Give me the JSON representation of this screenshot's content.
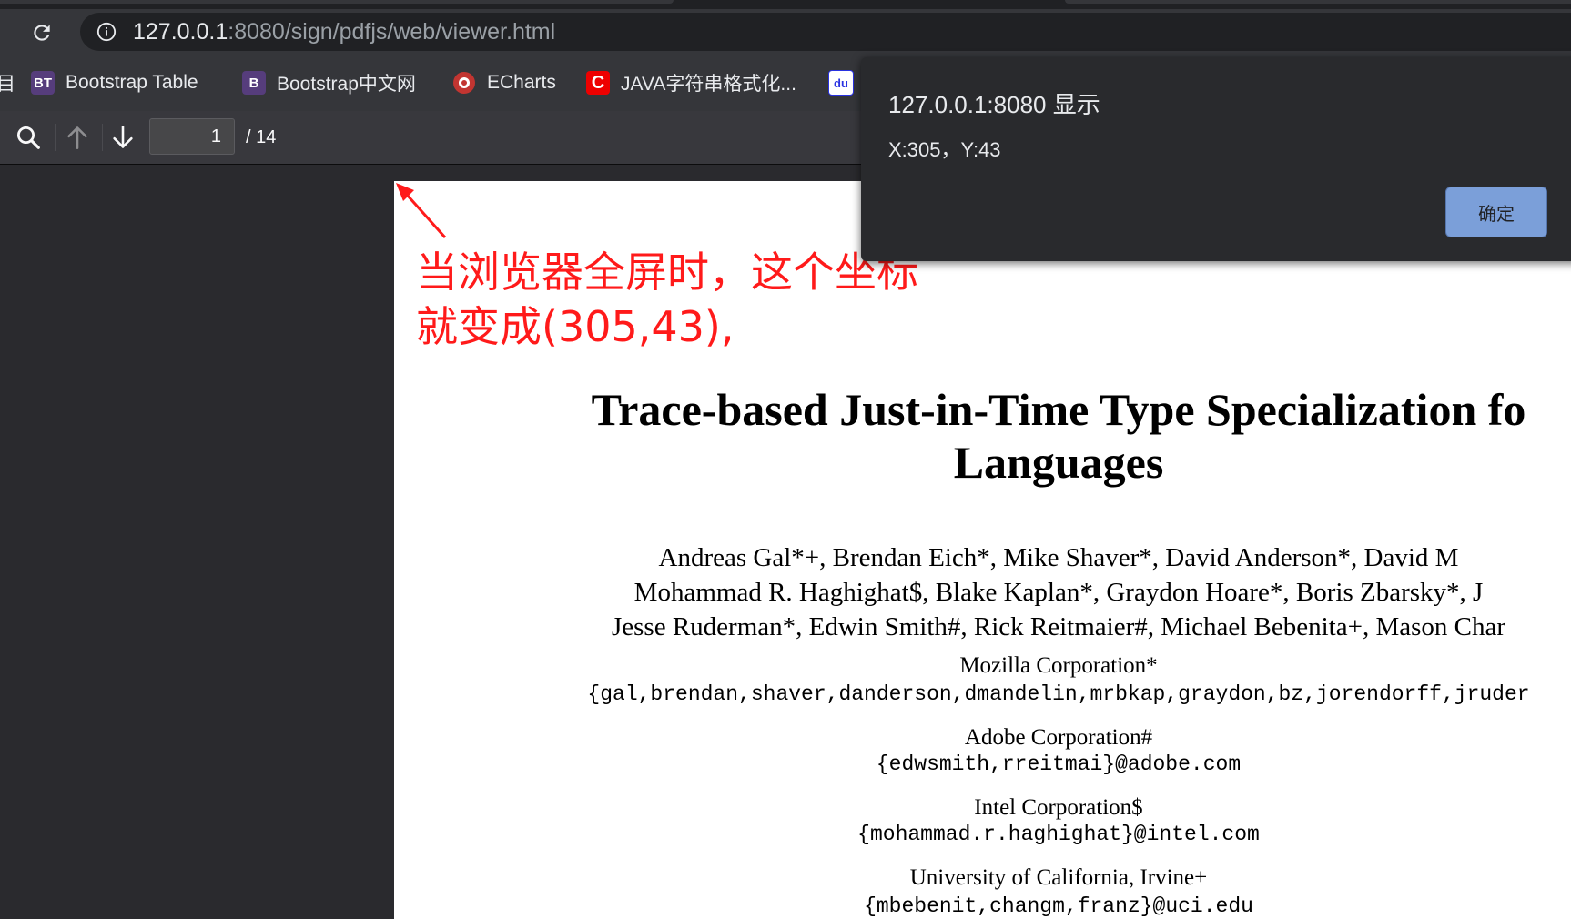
{
  "browser": {
    "url_host": "127.0.0.1",
    "url_path": ":8080/sign/pdfjs/web/viewer.html",
    "bookmarks": [
      {
        "icon": "BT",
        "label": "Bootstrap Table",
        "color": "#563d7c"
      },
      {
        "icon": "B",
        "label": "Bootstrap中文网",
        "color": "#563d7c"
      },
      {
        "icon": "echarts-icon",
        "label": "ECharts",
        "color": "#c23531"
      },
      {
        "icon": "C",
        "label": "JAVA字符串格式化...",
        "color": "#e00"
      },
      {
        "icon": "du",
        "label": "",
        "color": "#2932e1"
      }
    ]
  },
  "pdf_toolbar": {
    "page_number": "1",
    "page_count": "/ 14"
  },
  "annotation": {
    "line1": "当浏览器全屏时，这个坐标",
    "line2": "就变成(305,43),",
    "color": "#ff1a1a"
  },
  "paper": {
    "title_line1": "Trace-based Just-in-Time Type Specialization fo",
    "title_line2": "Languages",
    "authors_line1": "Andreas Gal*+, Brendan Eich*, Mike Shaver*, David Anderson*, David M",
    "authors_line2": "Mohammad R. Haghighat$, Blake Kaplan*, Graydon Hoare*, Boris Zbarsky*, J",
    "authors_line3": "Jesse Ruderman*, Edwin Smith#, Rick Reitmaier#, Michael Bebenita+, Mason Char",
    "affiliations": [
      {
        "name": "Mozilla Corporation*",
        "email": "{gal,brendan,shaver,danderson,dmandelin,mrbkap,graydon,bz,jorendorff,jruder"
      },
      {
        "name": "Adobe Corporation#",
        "email": "{edwsmith,rreitmai}@adobe.com"
      },
      {
        "name": "Intel Corporation$",
        "email": "{mohammad.r.haghighat}@intel.com"
      },
      {
        "name": "University of California, Irvine+",
        "email": "{mbebenit,changm,franz}@uci.edu"
      }
    ]
  },
  "dialog": {
    "title": "127.0.0.1:8080 显示",
    "message": "X:305，Y:43",
    "ok_label": "确定",
    "accent": "#8ab4f8"
  }
}
